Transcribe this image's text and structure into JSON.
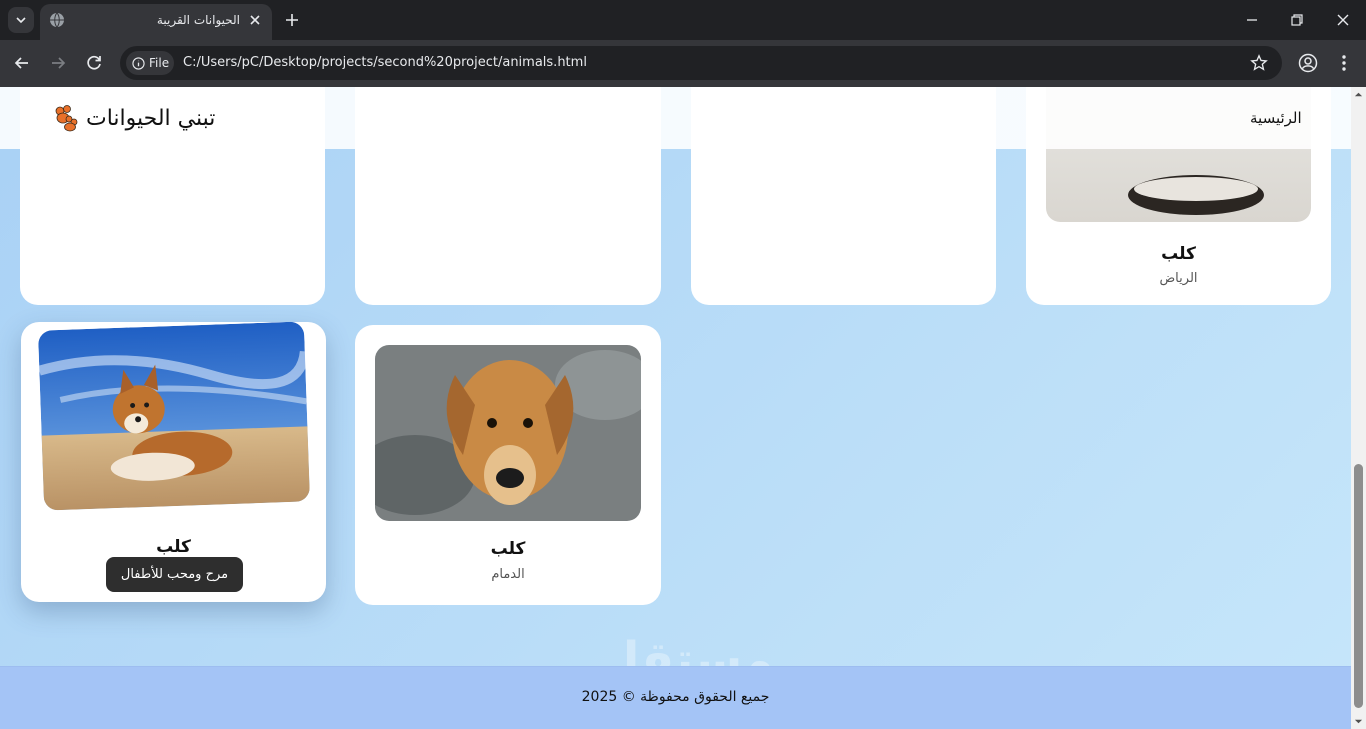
{
  "browser": {
    "tab_title": "الحيوانات القريبة",
    "file_chip": "File",
    "url": "C:/Users/pC/Desktop/projects/second%20project/animals.html"
  },
  "site": {
    "nav_home": "الرئيسية",
    "brand": "تبني الحيوانات",
    "footer": "جميع الحقوق محفوظة © 2025",
    "watermark": "مستقل"
  },
  "cards": [
    {
      "name": "كلب",
      "city": "الرياض"
    },
    {
      "name": "كلب",
      "city": "الدمام"
    },
    {
      "name": "كلب",
      "city": ""
    }
  ],
  "tooltip": "مرح ومحب للأطفال",
  "colors": {
    "page_bg": "#bbdef8",
    "footer_bg": "#a4c4f6",
    "card_bg": "#ffffff",
    "chrome_dark": "#202124"
  }
}
